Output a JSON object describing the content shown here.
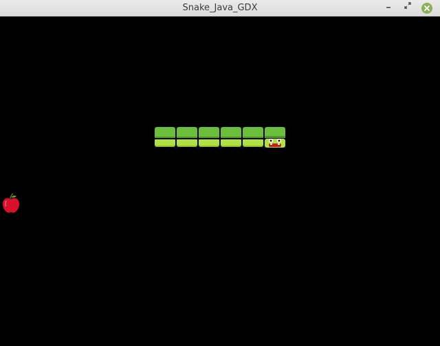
{
  "window": {
    "title": "Snake_Java_GDX",
    "minimize_icon": "minimize-icon",
    "maximize_icon": "restore-icon",
    "close_icon": "close-icon",
    "close_color": "#8bb05a"
  },
  "game": {
    "background": "#000000",
    "snake": {
      "direction": "right",
      "body_segments": 5,
      "body_color_top": "#6cbf3c",
      "body_color_bottom": "#b2e042",
      "head_icon": "snake-head-icon"
    },
    "food": {
      "type": "apple",
      "icon": "apple-icon",
      "color": "#d8102a"
    }
  }
}
